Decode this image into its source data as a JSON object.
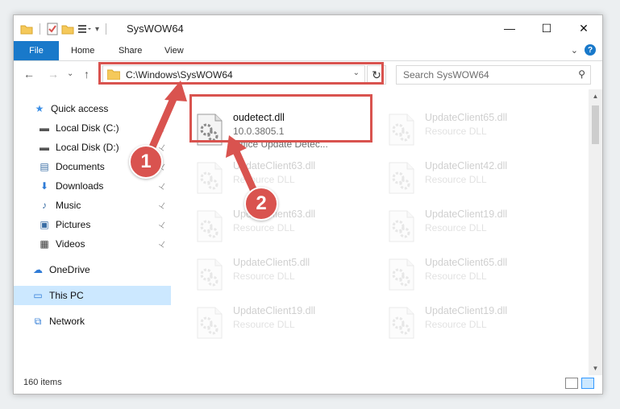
{
  "window": {
    "title": "SysWOW64",
    "minimize": "—",
    "maximize": "☐",
    "close": "✕"
  },
  "ribbon": {
    "tabs": [
      "File",
      "Home",
      "Share",
      "View"
    ],
    "expand": "⌄",
    "help": "?"
  },
  "nav": {
    "back": "←",
    "forward": "→",
    "recent": "⌄",
    "up": "↑",
    "address": "C:\\Windows\\SysWOW64",
    "address_chevron": "⌄",
    "refresh": "↻",
    "search_placeholder": "Search SysWOW64",
    "search_icon": "⚲"
  },
  "sidebar": {
    "items": [
      {
        "label": "Quick access",
        "icon": "★",
        "icon_color": "#3a8ee6",
        "pinned": false
      },
      {
        "label": "Local Disk (C:)",
        "icon": "▬",
        "icon_color": "#555",
        "pinned": true
      },
      {
        "label": "Local Disk (D:)",
        "icon": "▬",
        "icon_color": "#555",
        "pinned": true
      },
      {
        "label": "Documents",
        "icon": "▤",
        "icon_color": "#3a6ea5",
        "pinned": true
      },
      {
        "label": "Downloads",
        "icon": "⬇",
        "icon_color": "#2f7bd6",
        "pinned": true
      },
      {
        "label": "Music",
        "icon": "♪",
        "icon_color": "#3a6ea5",
        "pinned": true
      },
      {
        "label": "Pictures",
        "icon": "▣",
        "icon_color": "#3a6ea5",
        "pinned": true
      },
      {
        "label": "Videos",
        "icon": "▦",
        "icon_color": "#333",
        "pinned": true
      },
      {
        "label": "OneDrive",
        "icon": "☁",
        "icon_color": "#2f7bd6",
        "pinned": false
      },
      {
        "label": "This PC",
        "icon": "▭",
        "icon_color": "#2f7bd6",
        "pinned": false,
        "selected": true
      },
      {
        "label": "Network",
        "icon": "⧉",
        "icon_color": "#2f7bd6",
        "pinned": false
      }
    ],
    "pin_glyph": "📌"
  },
  "files": [
    {
      "name": "oudetect.dll",
      "line2": "10.0.3805.1",
      "line3": "Office Update Detec...",
      "faded": false
    },
    {
      "name": "UpdateClient65.dll",
      "line2": "Resource DLL",
      "faded": true
    },
    {
      "name": "UpdateClient63.dll",
      "line2": "Resource DLL",
      "faded": true
    },
    {
      "name": "UpdateClient42.dll",
      "line2": "Resource DLL",
      "faded": true
    },
    {
      "name": "UpdateClient63.dll",
      "line2": "Resource DLL",
      "faded": true
    },
    {
      "name": "UpdateClient19.dll",
      "line2": "Resource DLL",
      "faded": true
    },
    {
      "name": "UpdateClient5.dll",
      "line2": "Resource DLL",
      "faded": true
    },
    {
      "name": "UpdateClient65.dll",
      "line2": "Resource DLL",
      "faded": true
    },
    {
      "name": "UpdateClient19.dll",
      "line2": "Resource DLL",
      "faded": true
    },
    {
      "name": "UpdateClient19.dll",
      "line2": "Resource DLL",
      "faded": true
    }
  ],
  "annotations": {
    "badge1": "1",
    "badge2": "2",
    "color": "#d9534f"
  },
  "status": {
    "item_count": "160 items"
  }
}
